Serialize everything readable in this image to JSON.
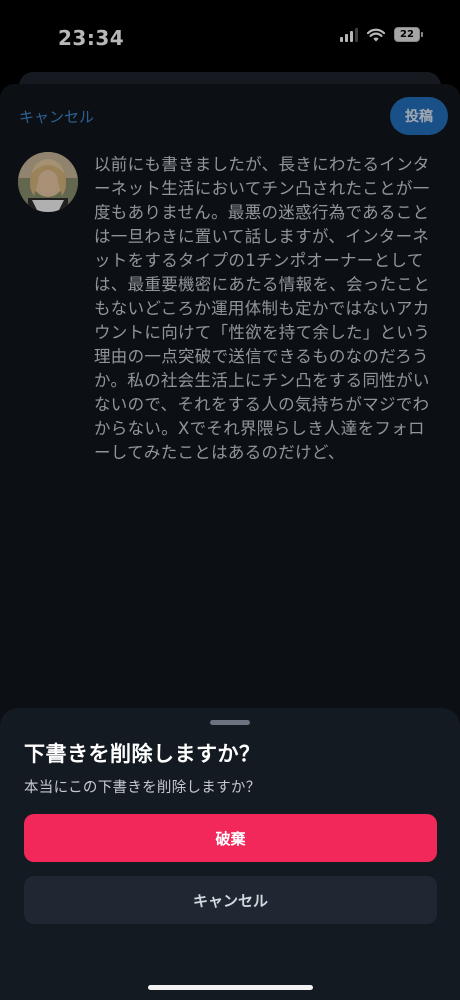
{
  "status_bar": {
    "time": "23:34",
    "battery": "22",
    "icons": [
      "signal-icon",
      "wifi-icon",
      "battery-icon"
    ]
  },
  "compose": {
    "cancel_label": "キャンセル",
    "post_label": "投稿",
    "text": "以前にも書きましたが、長きにわたるインターネット生活においてチン凸されたことが一度もありません。最悪の迷惑行為であることは一旦わきに置いて話しますが、インターネットをするタイプの1チンポオーナーとしては、最重要機密にあたる情報を、会ったこともないどころか運用体制も定かではないアカウントに向けて「性欲を持て余した」という理由の一点突破で送信できるものなのだろうか。私の社会生活上にチン凸をする同性がいないので、それをする人の気持ちがマジでわからない。Xでそれ界隈らしき人達をフォローしてみたことはあるのだけど、"
  },
  "dialog": {
    "title": "下書きを削除しますか？",
    "body": "本当にこの下書きを削除しますか？",
    "discard_label": "破棄",
    "cancel_label": "キャンセル"
  },
  "colors": {
    "accent": "#2470bd",
    "link": "#3f86c9",
    "destructive": "#f2285a",
    "background": "#11161d"
  }
}
